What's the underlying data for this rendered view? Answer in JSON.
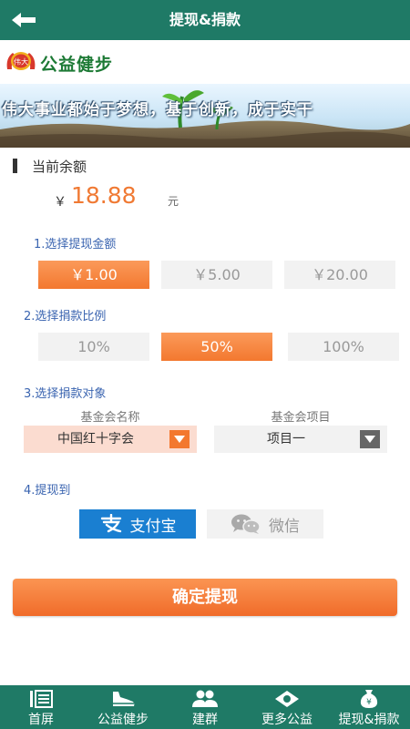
{
  "header": {
    "title": "提现&捐款",
    "back_icon": "back-arrow-icon"
  },
  "logo": {
    "text": "公益健步",
    "emblem_text": "伟大"
  },
  "banner": {
    "slogan": "伟大事业都始于梦想，基于创新，成于实干"
  },
  "balance": {
    "title": "当前余额",
    "currency": "￥",
    "value": "18.88",
    "unit": "元"
  },
  "withdraw": {
    "label": "1.选择提现金额",
    "options": [
      "￥1.00",
      "￥5.00",
      "￥20.00"
    ],
    "selected_index": 0
  },
  "donation_ratio": {
    "label": "2.选择捐款比例",
    "options": [
      "10%",
      "50%",
      "100%"
    ],
    "selected_index": 1
  },
  "donation_target": {
    "label": "3.选择捐款对象",
    "foundation_name_header": "基金会名称",
    "foundation_project_header": "基金会项目",
    "foundation_name_value": "中国红十字会",
    "foundation_project_value": "项目一"
  },
  "payout": {
    "label": "4.提现到",
    "alipay_label": "支付宝",
    "wechat_label": "微信",
    "selected": "alipay"
  },
  "confirm_label": "确定提现",
  "nav": [
    {
      "label": "首屏",
      "icon": "home-list-icon"
    },
    {
      "label": "公益健步",
      "icon": "shoe-icon"
    },
    {
      "label": "建群",
      "icon": "group-icon"
    },
    {
      "label": "更多公益",
      "icon": "more-icon"
    },
    {
      "label": "提现&捐款",
      "icon": "wallet-icon"
    }
  ],
  "colors": {
    "primary": "#1f7a66",
    "accent": "#f3782f",
    "link": "#3a64b0",
    "alipay": "#1a7fd1"
  }
}
